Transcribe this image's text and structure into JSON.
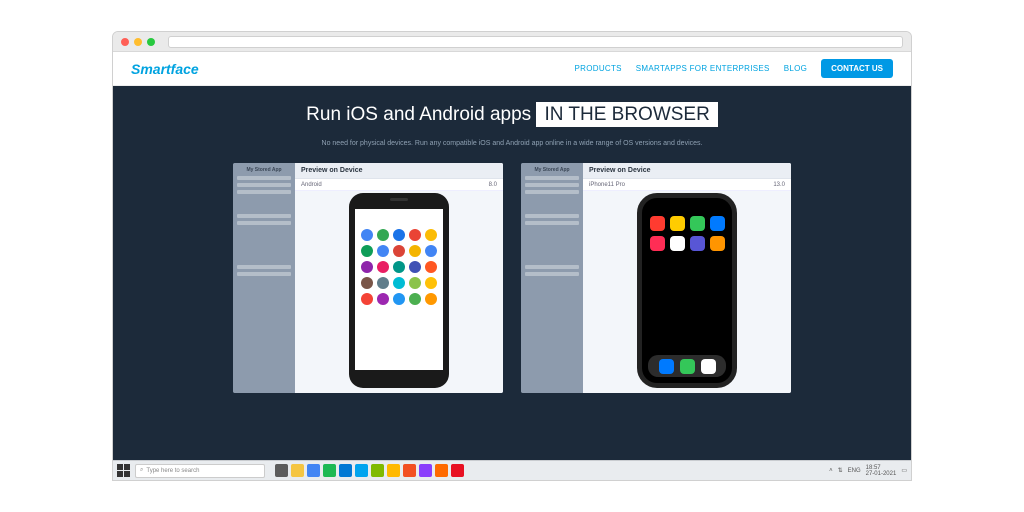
{
  "logo": "Smartface",
  "nav": {
    "products": "PRODUCTS",
    "smartapps": "SMARTAPPS FOR ENTERPRISES",
    "blog": "BLOG",
    "cta": "CONTACT US"
  },
  "hero": {
    "title_plain": "Run iOS and Android apps ",
    "title_boxed": "IN THE BROWSER",
    "sub": "No need for physical devices. Run any compatible iOS and Android app online in a wide range of OS versions and devices."
  },
  "panes": {
    "left": {
      "head": "Preview on Device",
      "sub_left": "Android",
      "sub_right": "8.0",
      "side_title": "My Stored App"
    },
    "right": {
      "head": "Preview on Device",
      "sub_left": "iPhone11 Pro",
      "sub_right": "13.0",
      "side_title": "My Stored App"
    }
  },
  "android_icons": [
    "#4285f4",
    "#34a853",
    "#1a73e8",
    "#ea4335",
    "#fbbc05",
    "#0f9d58",
    "#4285f4",
    "#db4437",
    "#f4b400",
    "#4285f4",
    "#8e24aa",
    "#e91e63",
    "#009688",
    "#3f51b5",
    "#ff5722",
    "#795548",
    "#607d8b",
    "#00bcd4",
    "#8bc34a",
    "#ffc107",
    "#f44336",
    "#9c27b0",
    "#2196f3",
    "#4caf50",
    "#ff9800"
  ],
  "ios_icons": [
    "#ff3b30",
    "#ffcc00",
    "#34c759",
    "#007aff",
    "#ff2d55",
    "#ffffff",
    "#5856d6",
    "#ff9500"
  ],
  "dock_icons": [
    "#007aff",
    "#34c759",
    "#ffffff"
  ],
  "taskbar": {
    "search_placeholder": "Type here to search",
    "icons": [
      "#5c5c5c",
      "#f5c542",
      "#4285f4",
      "#1db954",
      "#0078d4",
      "#00a4ef",
      "#7fba00",
      "#ffb900",
      "#f25022",
      "#8a3ffc",
      "#ff6a00",
      "#e81123"
    ],
    "lang": "ENG",
    "time": "18:57",
    "date": "27-01-2021"
  }
}
